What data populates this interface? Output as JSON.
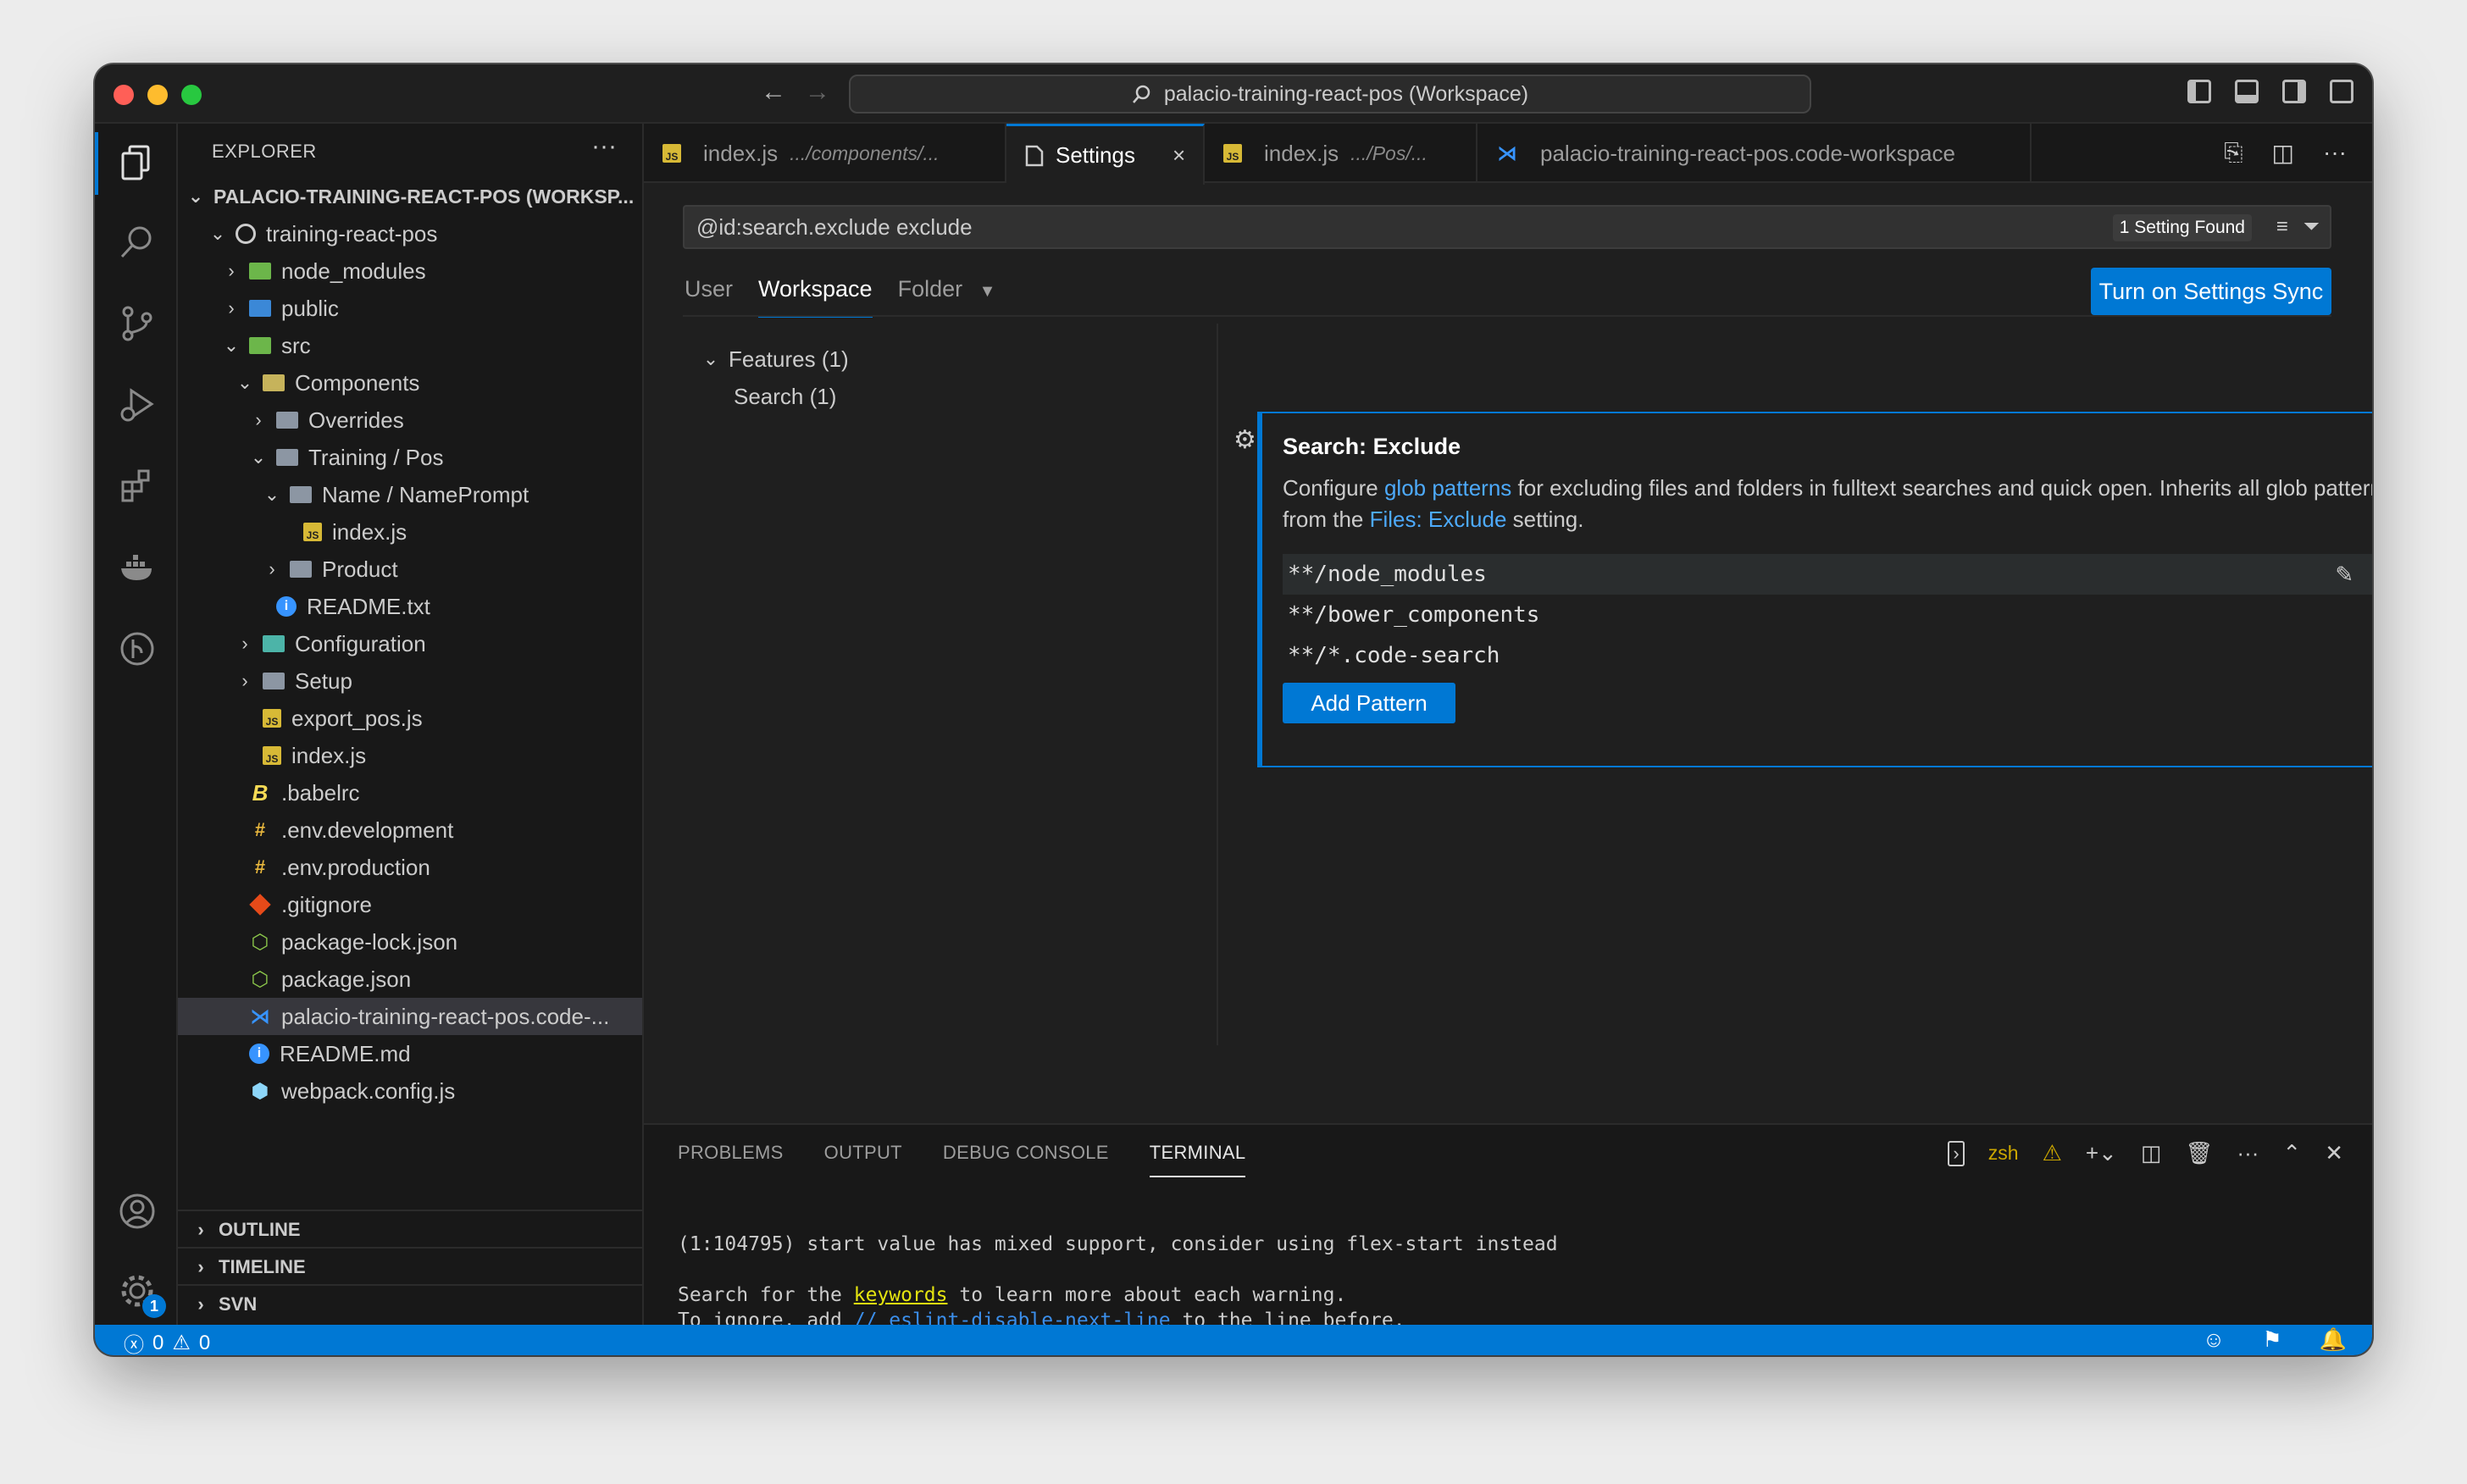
{
  "window": {
    "title": "palacio-training-react-pos (Workspace)",
    "nav_back": "←",
    "nav_forward": "→"
  },
  "activity_bar": {
    "items": [
      "explorer-icon",
      "search-icon",
      "source-control-icon",
      "run-debug-icon",
      "extensions-icon",
      "docker-icon",
      "git-graph-icon"
    ],
    "bottom": [
      "account-icon",
      "manage-gear-icon"
    ],
    "manage_badge": "1"
  },
  "explorer": {
    "title": "EXPLORER",
    "more": "···",
    "root": "PALACIO-TRAINING-REACT-POS (WORKSP...",
    "items": [
      {
        "label": "training-react-pos"
      },
      {
        "label": "node_modules"
      },
      {
        "label": "public"
      },
      {
        "label": "src"
      },
      {
        "label": "Components"
      },
      {
        "label": "Overrides"
      },
      {
        "label": "Training / Pos"
      },
      {
        "label": "Name / NamePrompt"
      },
      {
        "label": "index.js"
      },
      {
        "label": "Product"
      },
      {
        "label": "README.txt"
      },
      {
        "label": "Configuration"
      },
      {
        "label": "Setup"
      },
      {
        "label": "export_pos.js"
      },
      {
        "label": "index.js"
      },
      {
        "label": ".babelrc"
      },
      {
        "label": ".env.development"
      },
      {
        "label": ".env.production"
      },
      {
        "label": ".gitignore"
      },
      {
        "label": "package-lock.json"
      },
      {
        "label": "package.json"
      },
      {
        "label": "palacio-training-react-pos.code-..."
      },
      {
        "label": "README.md"
      },
      {
        "label": "webpack.config.js"
      }
    ],
    "sections": [
      "OUTLINE",
      "TIMELINE",
      "SVN"
    ]
  },
  "tabs": [
    {
      "label": "index.js",
      "desc": ".../components/..."
    },
    {
      "label": "Settings",
      "close": "×"
    },
    {
      "label": "index.js",
      "desc": ".../Pos/..."
    },
    {
      "label": "palacio-training-react-pos.code-workspace"
    }
  ],
  "settings": {
    "search_value": "@id:search.exclude exclude",
    "found": "1 Setting Found",
    "scopes": [
      "User",
      "Workspace",
      "Folder"
    ],
    "sync_button": "Turn on Settings Sync",
    "toc": [
      "Features (1)",
      "Search (1)"
    ],
    "setting": {
      "category": "Search: ",
      "name": "Exclude",
      "desc_1": "Configure ",
      "link_1": "glob patterns",
      "desc_2": " for excluding files and folders in fulltext searches and quick open. Inherits all glob patterns from the ",
      "link_2": "Files: Exclude",
      "desc_3": " setting.",
      "patterns": [
        "**/node_modules",
        "**/bower_components",
        "**/*.code-search"
      ],
      "add_button": "Add Pattern"
    }
  },
  "panel": {
    "tabs": [
      "PROBLEMS",
      "OUTPUT",
      "DEBUG CONSOLE",
      "TERMINAL"
    ],
    "shell": "zsh",
    "terminal": {
      "line1": "(1:104795) start value has mixed support, consider using flex-start instead",
      "line2_a": "Search for the ",
      "line2_kw": "keywords",
      "line2_b": " to learn more about each warning.",
      "line3_a": "To ignore, add ",
      "line3_c": "// eslint-disable-next-line",
      "line3_b": " to the line before."
    }
  },
  "statusbar": {
    "errors": "0",
    "warnings": "0"
  },
  "colors": {
    "accent": "#0078d4",
    "background": "#1f1f1f",
    "sidebar": "#181818"
  }
}
